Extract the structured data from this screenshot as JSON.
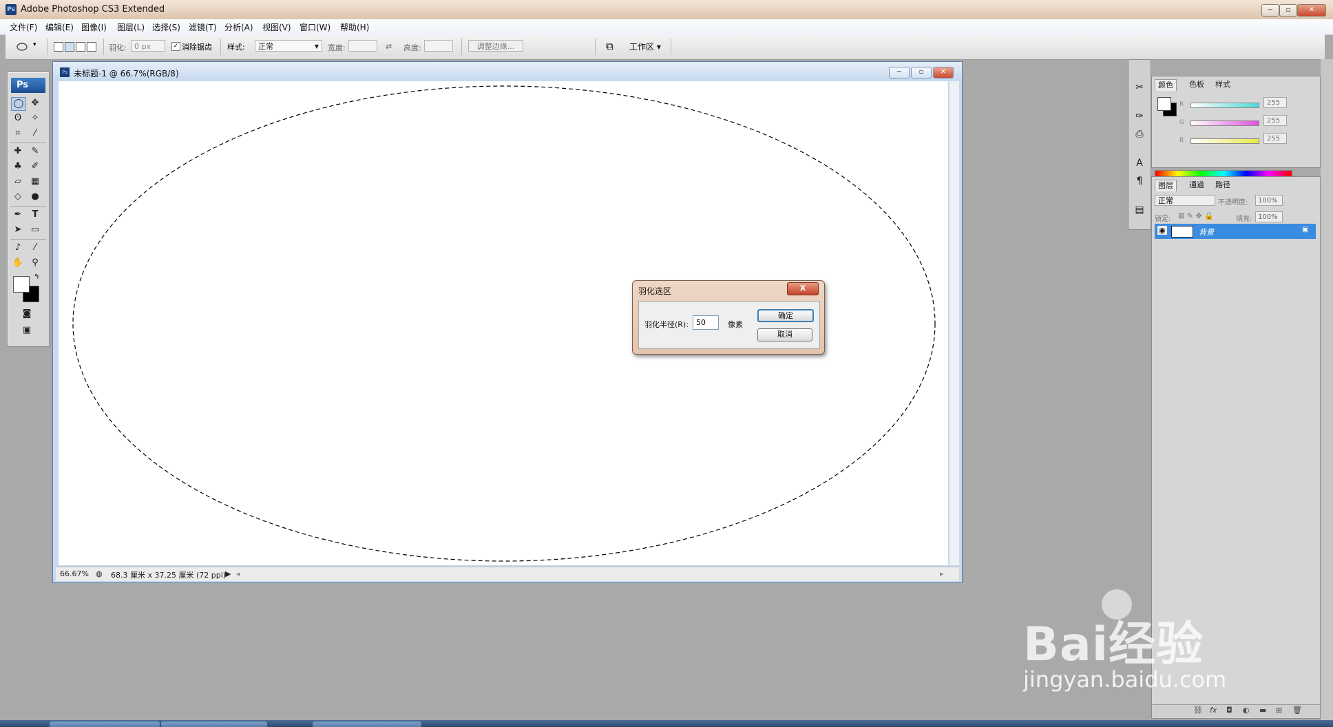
{
  "app": {
    "title": "Adobe Photoshop CS3 Extended",
    "icon_label": "Ps"
  },
  "window_controls": {
    "minimize": "−",
    "restore": "▫",
    "close": "✕"
  },
  "menu": [
    "文件(F)",
    "编辑(E)",
    "图像(I)",
    "图层(L)",
    "选择(S)",
    "滤镜(T)",
    "分析(A)",
    "视图(V)",
    "窗口(W)",
    "帮助(H)"
  ],
  "options": {
    "feather_label": "羽化:",
    "feather_value": "0 px",
    "antialias_label": "消除锯齿",
    "antialias_checked": "✓",
    "style_label": "样式:",
    "style_value": "正常",
    "width_label": "宽度:",
    "height_label": "高度:",
    "refine_edge": "调整边缘...",
    "workspace": "工作区 ▾"
  },
  "toolbox": {
    "logo": "Ps"
  },
  "document": {
    "title": "未标题-1 @ 66.7%(RGB/8)",
    "zoom": "66.67%",
    "doc_size": "68.3 厘米 x 37.25 厘米 (72 ppi)"
  },
  "dialog": {
    "title": "羽化选区",
    "close": "X",
    "radius_label": "羽化半径(R):",
    "radius_value": "50",
    "unit": "像素",
    "ok": "确定",
    "cancel": "取消"
  },
  "color_panel": {
    "tabs": [
      "颜色",
      "色板",
      "样式"
    ],
    "channels": [
      {
        "label": "R",
        "value": "255",
        "color": "#4fd9d9"
      },
      {
        "label": "G",
        "value": "255",
        "color": "#e050e0"
      },
      {
        "label": "B",
        "value": "255",
        "color": "#e8e84a"
      }
    ]
  },
  "layers_panel": {
    "tabs": [
      "图层",
      "通道",
      "路径"
    ],
    "blend_mode": "正常",
    "opacity_label": "不透明度:",
    "opacity_value": "100%",
    "lock_label": "锁定:",
    "fill_label": "填充:",
    "fill_value": "100%",
    "layer_name": "背景"
  },
  "watermark": {
    "main": "Bai经验",
    "sub": "jingyan.baidu.com"
  },
  "colors": {
    "accent": "#3a8ce0",
    "app_bg": "#a9a9a9",
    "dialog_frame": "#e4c3ad"
  }
}
